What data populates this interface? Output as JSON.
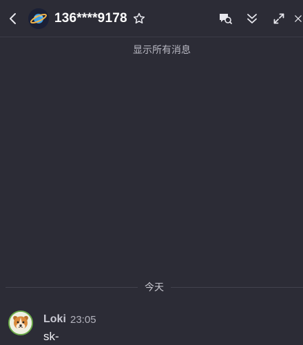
{
  "header": {
    "title": "136****9178",
    "icons": {
      "back": "chevron-left-icon",
      "avatar": "planet-icon",
      "favorite": "star-outline-icon",
      "search_messages": "chat-search-icon",
      "scroll_bottom": "double-chevron-down-icon",
      "expand": "expand-arrows-icon",
      "close": "close-icon"
    }
  },
  "main": {
    "show_all_messages": "显示所有消息",
    "date_divider": "今天",
    "messages": [
      {
        "sender": "Loki",
        "time": "23:05",
        "text": "sk-",
        "avatar_icon": "dog-avatar-icon"
      }
    ]
  },
  "colors": {
    "background": "#2c2c36",
    "title_text": "#ffffff",
    "muted_text": "#b9b9c3",
    "avatar_border": "#6aaa48"
  }
}
